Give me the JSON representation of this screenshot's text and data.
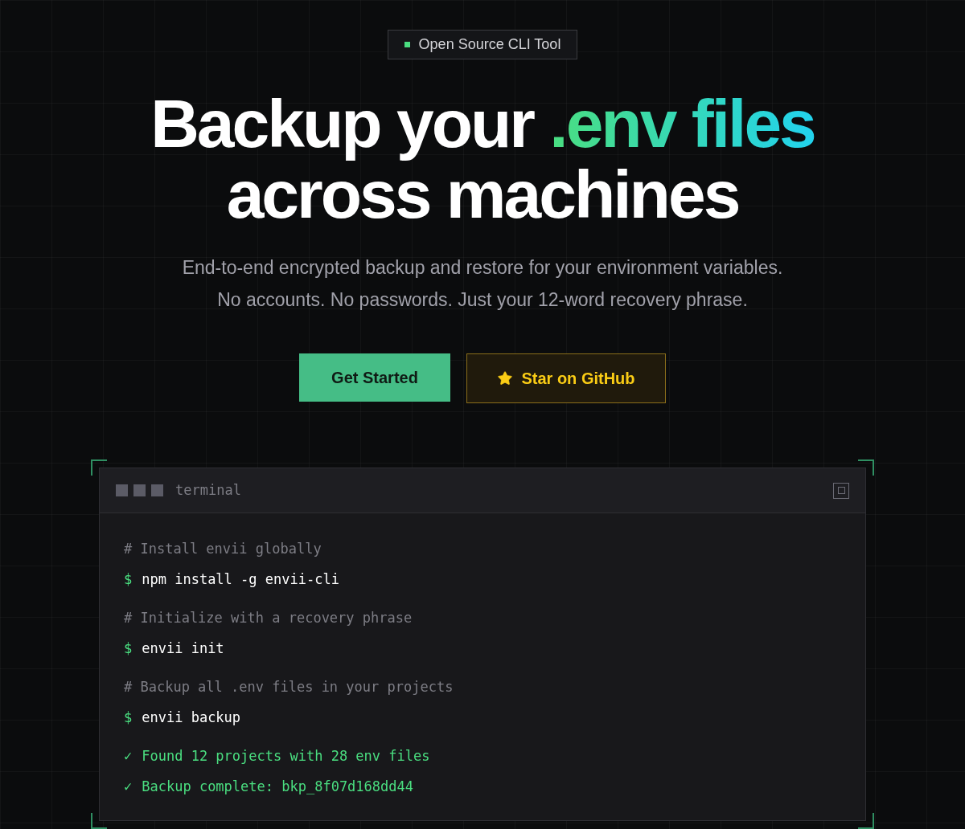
{
  "badge": {
    "label": "Open Source CLI Tool"
  },
  "headline": {
    "line1": "Backup your ",
    "highlight": ".env files",
    "line2": "across machines"
  },
  "subtitle": [
    "End-to-end encrypted backup and restore for your environment variables.",
    "No accounts. No passwords. Just your 12-word recovery phrase."
  ],
  "buttons": [
    {
      "kind": "primary",
      "label": "Get Started"
    },
    {
      "kind": "star",
      "label": "Star on GitHub"
    }
  ],
  "terminal": {
    "title": "terminal",
    "groups": [
      [
        {
          "kind": "comment",
          "text": "# Install envii globally"
        },
        {
          "kind": "command",
          "prompt": "$",
          "text": "npm install -g envii-cli"
        }
      ],
      [
        {
          "kind": "comment",
          "text": "# Initialize with a recovery phrase"
        },
        {
          "kind": "command",
          "prompt": "$",
          "text": "envii init"
        }
      ],
      [
        {
          "kind": "comment",
          "text": "# Backup all .env files in your projects"
        },
        {
          "kind": "command",
          "prompt": "$",
          "text": "envii backup"
        }
      ],
      [
        {
          "kind": "output",
          "prompt": "✓",
          "text": "Found 12 projects with 28 env files"
        },
        {
          "kind": "output",
          "prompt": "✓",
          "text": "Backup complete: bkp_8f07d168dd44"
        }
      ]
    ]
  }
}
